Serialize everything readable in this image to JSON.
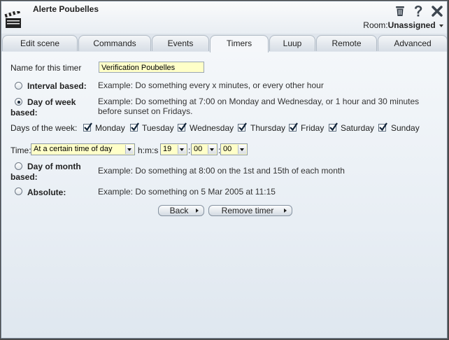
{
  "window": {
    "title": "Alerte Poubelles",
    "room_label": "Room:",
    "room_value": "Unassigned"
  },
  "tabs": [
    {
      "label": "Edit scene"
    },
    {
      "label": "Commands"
    },
    {
      "label": "Events"
    },
    {
      "label": "Timers",
      "active": true
    },
    {
      "label": "Luup"
    },
    {
      "label": "Remote"
    },
    {
      "label": "Advanced"
    }
  ],
  "form": {
    "name_label": "Name for this timer",
    "name_value": "Verification Poubelles",
    "interval": {
      "label": "Interval based:",
      "example": "Example: Do something every x minutes, or every other hour",
      "selected": false
    },
    "day_of_week": {
      "label": "Day of week based:",
      "example": "Example: Do something at 7:00 on Monday and Wednesday, or 1 hour and 30 minutes before sunset on Fridays.",
      "selected": true
    },
    "days_label": "Days of the week:",
    "days": [
      {
        "label": "Monday",
        "checked": true
      },
      {
        "label": "Tuesday",
        "checked": true
      },
      {
        "label": "Wednesday",
        "checked": true
      },
      {
        "label": "Thursday",
        "checked": true
      },
      {
        "label": "Friday",
        "checked": true
      },
      {
        "label": "Saturday",
        "checked": true
      },
      {
        "label": "Sunday",
        "checked": true
      }
    ],
    "time_label": "Time:",
    "time_mode": "At a certain time of day",
    "hms_label": "h:m:s",
    "hour": "19",
    "minute": "00",
    "second": "00",
    "colon": ":",
    "day_of_month": {
      "label": "Day of month based:",
      "example": "Example: Do something at 8:00 on the 1st and 15th of each month",
      "selected": false
    },
    "absolute": {
      "label": "Absolute:",
      "example": "Example: Do something on 5 Mar 2005 at 11:15",
      "selected": false
    }
  },
  "buttons": {
    "back": "Back",
    "remove": "Remove timer"
  },
  "colors": {
    "input_bg": "#ffffc8",
    "panel_bg": "#e6ecf2"
  }
}
